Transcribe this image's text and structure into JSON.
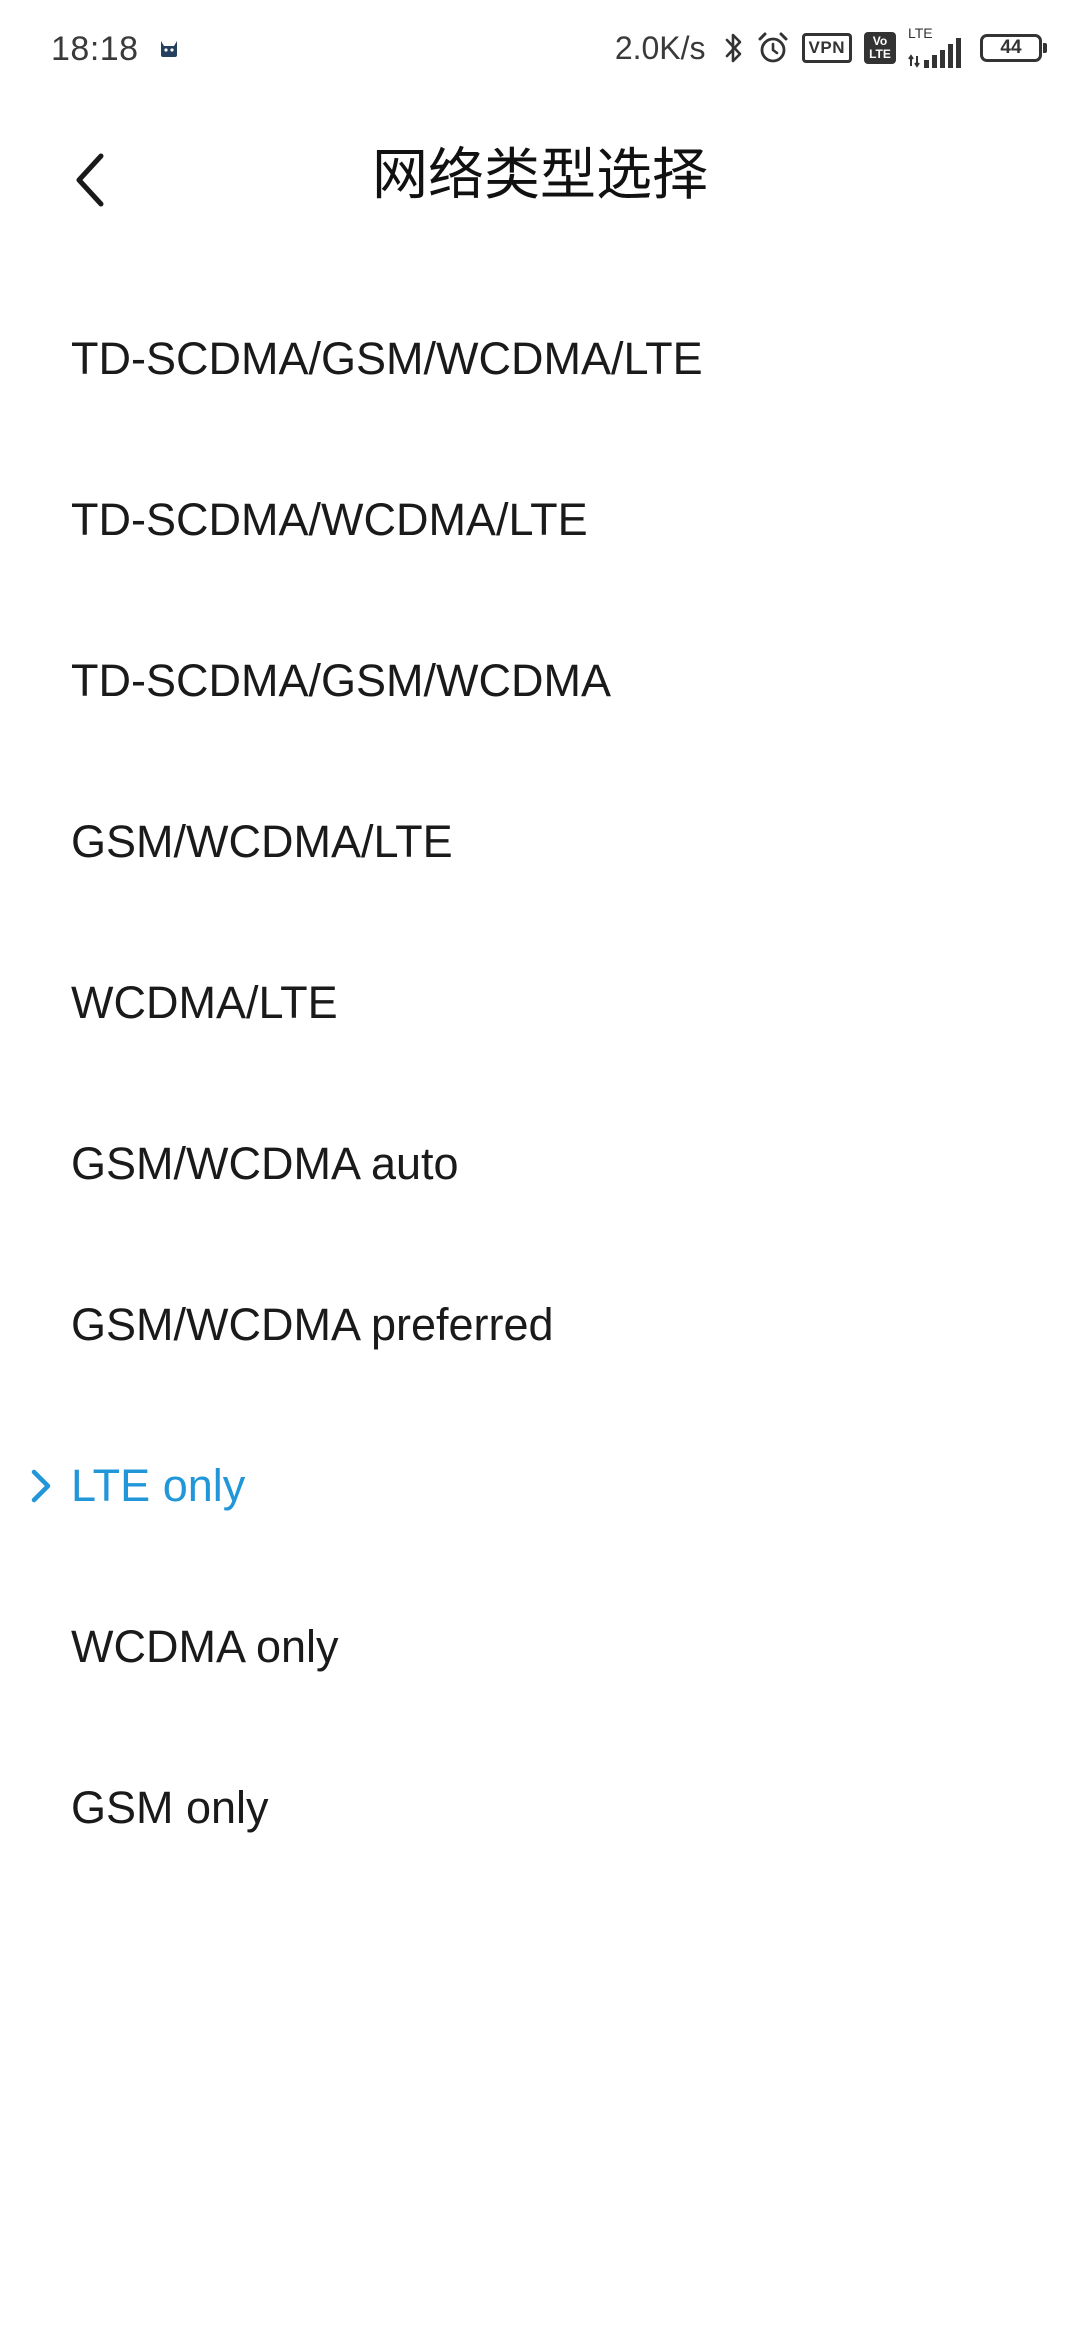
{
  "status_bar": {
    "time": "18:18",
    "net_speed": "2.0K/s",
    "vpn_label": "VPN",
    "volte_top": "Vo",
    "volte_bottom": "LTE",
    "lte_label": "LTE",
    "battery_level": "44",
    "icons": [
      "cat-app-icon",
      "bluetooth-icon",
      "alarm-icon",
      "vpn-icon",
      "volte-icon",
      "signal-icon",
      "battery-icon"
    ]
  },
  "header": {
    "title": "网络类型选择",
    "back_icon": "chevron-left-icon"
  },
  "options": [
    {
      "label": "TD-SCDMA/GSM/WCDMA/LTE",
      "selected": false
    },
    {
      "label": "TD-SCDMA/WCDMA/LTE",
      "selected": false
    },
    {
      "label": "TD-SCDMA/GSM/WCDMA",
      "selected": false
    },
    {
      "label": "GSM/WCDMA/LTE",
      "selected": false
    },
    {
      "label": "WCDMA/LTE",
      "selected": false
    },
    {
      "label": "GSM/WCDMA auto",
      "selected": false
    },
    {
      "label": "GSM/WCDMA preferred",
      "selected": false
    },
    {
      "label": "LTE only",
      "selected": true
    },
    {
      "label": "WCDMA only",
      "selected": false
    },
    {
      "label": "GSM only",
      "selected": false
    }
  ],
  "colors": {
    "accent": "#2196d9",
    "text": "#1a1a1a",
    "background": "#ffffff"
  }
}
